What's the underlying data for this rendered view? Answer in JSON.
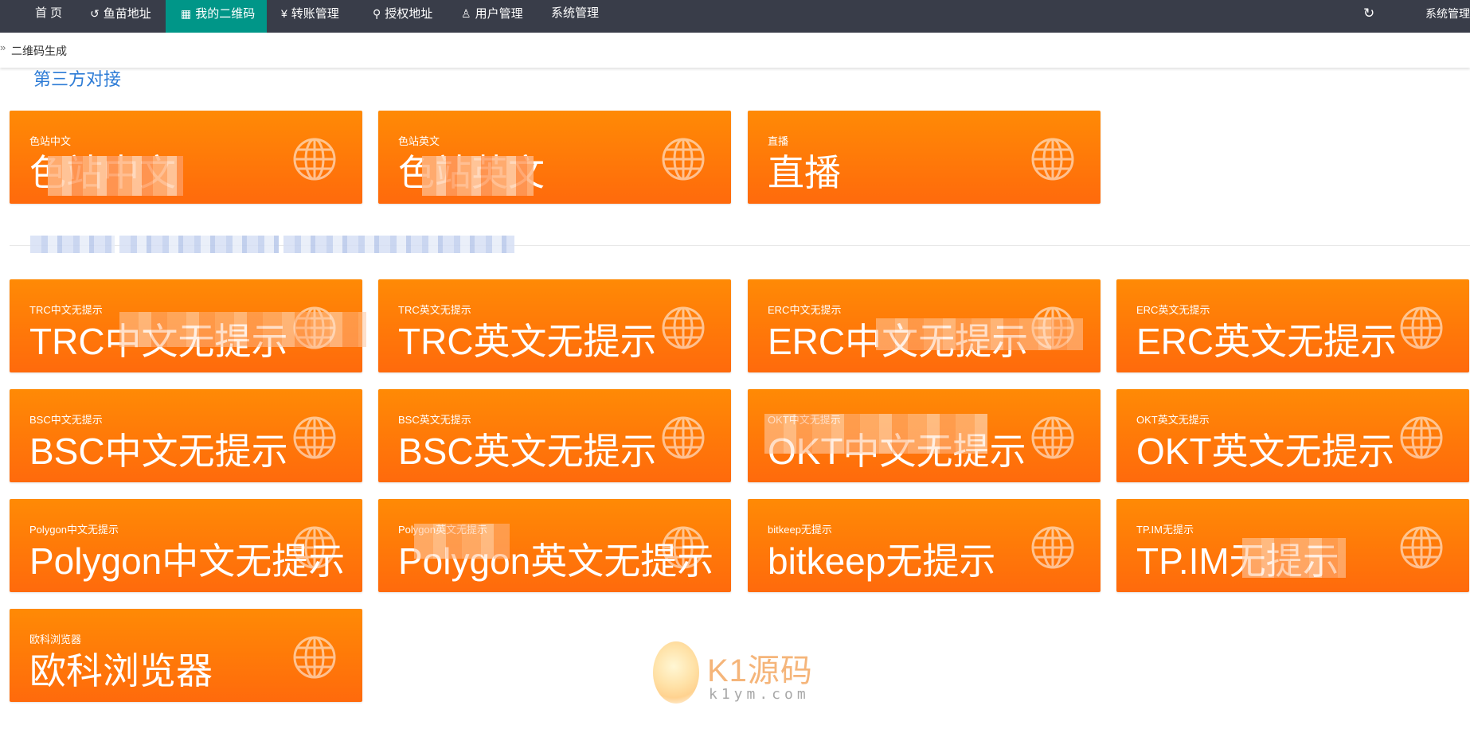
{
  "nav": {
    "items": [
      {
        "label": "首 页",
        "icon": ""
      },
      {
        "label": "鱼苗地址",
        "icon": "↺"
      },
      {
        "label": "我的二维码",
        "icon": "▦"
      },
      {
        "label": "转账管理",
        "icon": "¥"
      },
      {
        "label": "授权地址",
        "icon": "⚲"
      },
      {
        "label": "用户管理",
        "icon": "♙"
      },
      {
        "label": "系统管理",
        "icon": ""
      }
    ],
    "refresh_icon": "↻",
    "right_label": "系统管理"
  },
  "breadcrumb": {
    "arrow": "»",
    "label": "二维码生成"
  },
  "section": {
    "title": "第三方对接"
  },
  "cards": [
    {
      "small": "色站中文",
      "big": "色站中文"
    },
    {
      "small": "色站英文",
      "big": "色站英文"
    },
    {
      "small": "直播",
      "big": "直播"
    },
    {
      "small": "TRC中文无提示",
      "big": "TRC中文无提示"
    },
    {
      "small": "TRC英文无提示",
      "big": "TRC英文无提示"
    },
    {
      "small": "ERC中文无提示",
      "big": "ERC中文无提示"
    },
    {
      "small": "ERC英文无提示",
      "big": "ERC英文无提示"
    },
    {
      "small": "BSC中文无提示",
      "big": "BSC中文无提示"
    },
    {
      "small": "BSC英文无提示",
      "big": "BSC英文无提示"
    },
    {
      "small": "OKT中文无提示",
      "big": "OKT中文无提示"
    },
    {
      "small": "OKT英文无提示",
      "big": "OKT英文无提示"
    },
    {
      "small": "Polygon中文无提示",
      "big": "Polygon中文无提示"
    },
    {
      "small": "Polygon英文无提示",
      "big": "Polygon英文无提示"
    },
    {
      "small": "bitkeep无提示",
      "big": "bitkeep无提示"
    },
    {
      "small": "TP.IM无提示",
      "big": "TP.IM无提示"
    },
    {
      "small": "欧科浏览器",
      "big": "欧科浏览器"
    }
  ],
  "watermark": {
    "text": "K1源码",
    "sub": "k1ym.com"
  },
  "colors": {
    "nav_bg": "#393d49",
    "nav_active": "#009688",
    "card": "#ff7a08",
    "title": "#2e7cd6"
  }
}
